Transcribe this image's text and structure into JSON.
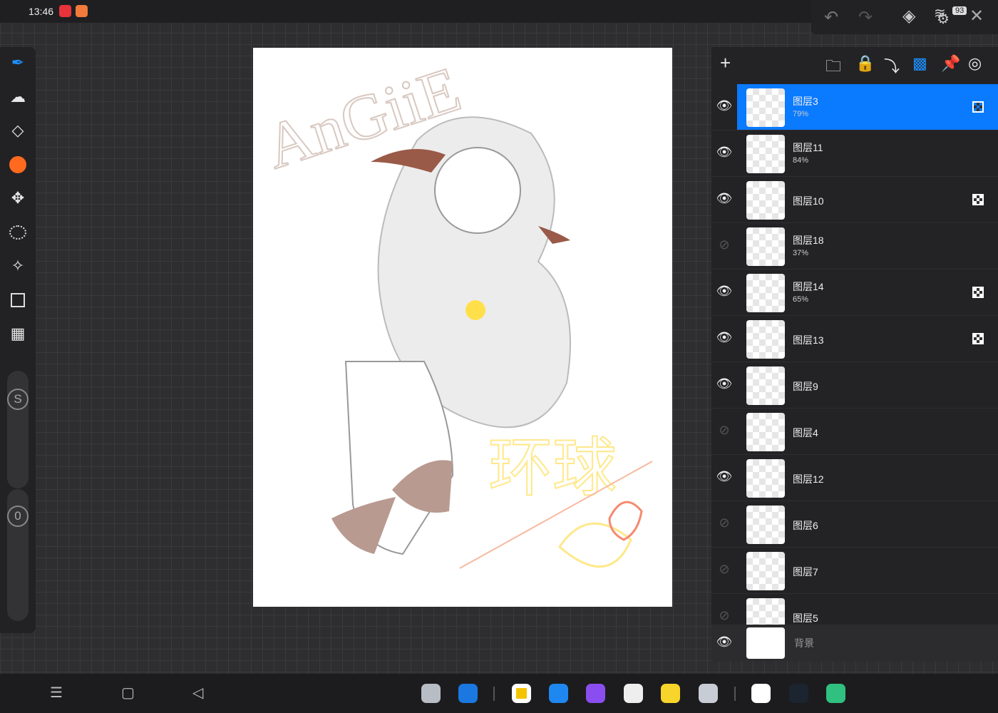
{
  "status": {
    "time": "13:46",
    "battery": "93"
  },
  "layers_panel": {
    "items": [
      {
        "name": "图层3",
        "opacity": "79%",
        "visible": true,
        "mask": true,
        "selected": true
      },
      {
        "name": "图层11",
        "opacity": "84%",
        "visible": true,
        "mask": false
      },
      {
        "name": "图层10",
        "opacity": "",
        "visible": true,
        "mask": true
      },
      {
        "name": "图层18",
        "opacity": "37%",
        "visible": false,
        "mask": false
      },
      {
        "name": "图层14",
        "opacity": "65%",
        "visible": true,
        "mask": true
      },
      {
        "name": "图层13",
        "opacity": "",
        "visible": true,
        "mask": true
      },
      {
        "name": "图层9",
        "opacity": "",
        "visible": true,
        "mask": false
      },
      {
        "name": "图层4",
        "opacity": "",
        "visible": false,
        "mask": false
      },
      {
        "name": "图层12",
        "opacity": "",
        "visible": true,
        "mask": false
      },
      {
        "name": "图层6",
        "opacity": "",
        "visible": false,
        "mask": false
      },
      {
        "name": "图层7",
        "opacity": "",
        "visible": false,
        "mask": false
      },
      {
        "name": "图层5",
        "opacity": "",
        "visible": false,
        "mask": false
      }
    ],
    "background": {
      "name": "背景",
      "visible": true
    }
  },
  "toolbar": {
    "size_label": "S",
    "opacity_label": "0",
    "color": "#ff6a1f"
  },
  "canvas": {
    "signature": "AnGiiE",
    "scribble": "环球"
  },
  "accent": "#0a7aff"
}
